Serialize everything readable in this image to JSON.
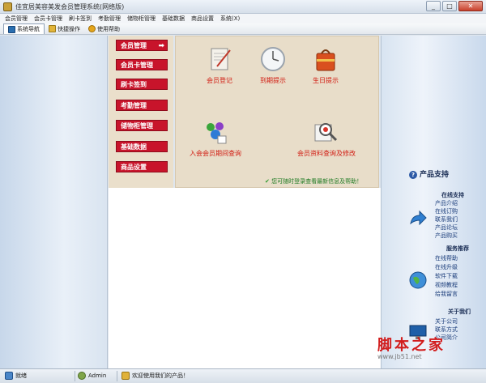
{
  "window": {
    "title": "佳宜居美容美发会员管理系统(网络版)",
    "minimize": "_",
    "maximize": "□",
    "close": "✕"
  },
  "menu": [
    "会员管理",
    "会员卡管理",
    "刷卡签到",
    "考勤管理",
    "储物柜管理",
    "基础数据",
    "商品设置",
    "系统(X)"
  ],
  "toolbar": [
    {
      "label": "系统导航",
      "active": true
    },
    {
      "label": "快捷操作",
      "active": false
    },
    {
      "label": "使用帮助",
      "active": false
    }
  ],
  "side_menu": [
    {
      "label": "会员管理",
      "selected": true
    },
    {
      "label": "会员卡管理",
      "selected": false
    },
    {
      "label": "刷卡签到",
      "selected": false
    },
    {
      "label": "考勤管理",
      "selected": false
    },
    {
      "label": "储物柜管理",
      "selected": false
    },
    {
      "label": "基础数据",
      "selected": false
    },
    {
      "label": "商品设置",
      "selected": false
    }
  ],
  "functions": [
    {
      "label": "会员登记",
      "icon": "document-scroll-icon"
    },
    {
      "label": "到期提示",
      "icon": "clock-icon"
    },
    {
      "label": "生日提示",
      "icon": "gift-bag-icon"
    },
    {
      "label": "入会会员期间查询",
      "icon": "people-icon"
    },
    {
      "label": "会员资料查询及修改",
      "icon": "magnifier-document-icon"
    }
  ],
  "tip": "您可随时登录查看最新信息及帮助！",
  "support": {
    "title": "产品支持",
    "groups": [
      {
        "title": "在线支持",
        "links": [
          "产品介绍",
          "在线订购",
          "联系我们",
          "产品论坛",
          "产品购买"
        ]
      },
      {
        "title": "服务推荐",
        "links": [
          "在线帮助",
          "在线升级",
          "软件下载",
          "视频教程",
          "给我留言"
        ]
      },
      {
        "title": "关于我们",
        "links": [
          "关于公司",
          "联系方式",
          "公司简介"
        ]
      }
    ]
  },
  "watermark": {
    "main": "脚本之家",
    "sub": "www.jb51.net"
  },
  "status": {
    "ready": "就绪",
    "user": "Admin",
    "message": "欢迎使用我们的产品！"
  },
  "colors": {
    "accent_red": "#c8142b",
    "panel_beige": "#e8ddc9",
    "func_label_red": "#d11a10"
  }
}
